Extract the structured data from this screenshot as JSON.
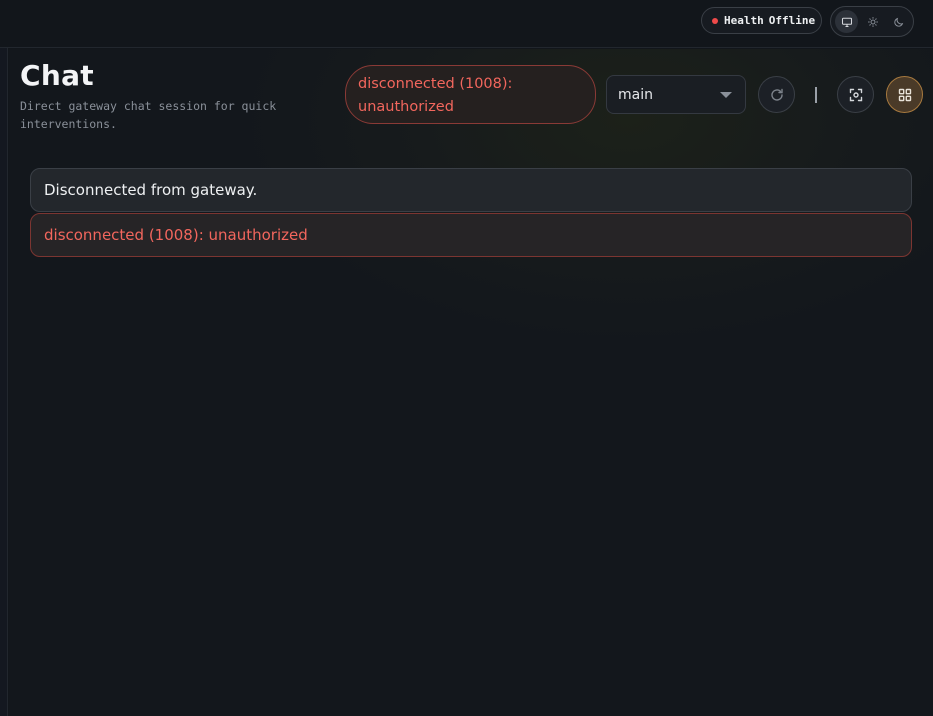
{
  "header": {
    "health": {
      "label": "Health",
      "status": "Offline",
      "status_color": "#ef4a4a"
    },
    "theme": {
      "options": [
        "system-icon",
        "sun-icon",
        "moon-icon"
      ],
      "active": "system-icon"
    }
  },
  "page": {
    "title": "Chat",
    "subtitle": "Direct gateway chat session for quick interventions."
  },
  "toolbar": {
    "connection_error": "disconnected (1008): unauthorized",
    "session_selected": "main",
    "refresh_icon": "refresh-icon",
    "focus_icon": "focus-icon",
    "grid_icon": "grid-icon",
    "accent_color": "#a87a3f"
  },
  "thread": {
    "messages": [
      {
        "kind": "info",
        "text": "Disconnected from gateway."
      },
      {
        "kind": "error",
        "text": "disconnected (1008): unauthorized"
      }
    ]
  },
  "colors": {
    "error": "#f2665d",
    "background": "#12161b"
  }
}
